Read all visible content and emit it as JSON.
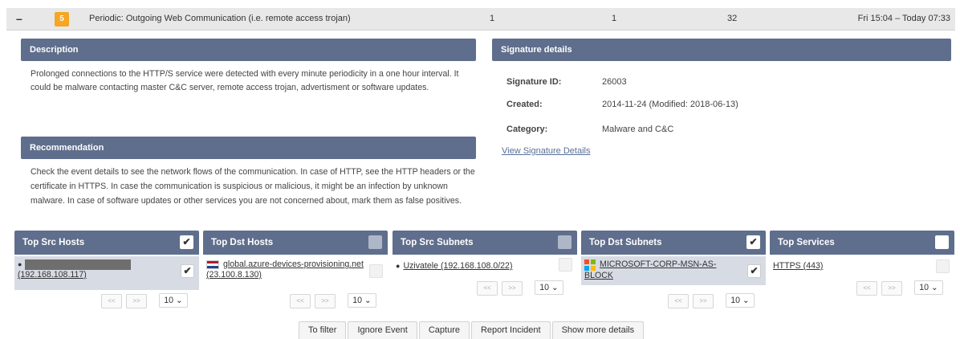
{
  "event": {
    "collapse": "–",
    "severity": "5",
    "title": "Periodic: Outgoing Web Communication (i.e. remote access trojan)",
    "col1": "1",
    "col2": "1",
    "col3": "32",
    "time": "Fri 15:04 – Today 07:33",
    "severity_color": "#f5a623"
  },
  "description": {
    "title": "Description",
    "text": "Prolonged connections to the HTTP/S service were detected with every minute periodicity in a one hour interval. It could be malware contacting master C&C server, remote access trojan, advertisment or software updates."
  },
  "recommendation": {
    "title": "Recommendation",
    "text": "Check the event details to see the network flows of the communication. In case of HTTP, see the HTTP headers or the certificate in HTTPS. In case the communication is suspicious or malicious, it might be an infection by unknown malware. In case of software updates or other services you are not concerned about, mark them as false positives."
  },
  "signature": {
    "title": "Signature details",
    "id_label": "Signature ID:",
    "id_value": "26003",
    "created_label": "Created:",
    "created_value": "2014-11-24 (Modified: 2018-06-13)",
    "category_label": "Category:",
    "category_value": "Malware and C&C",
    "link": "View Signature Details"
  },
  "boxes": {
    "src_hosts": {
      "title": "Top Src Hosts",
      "checked": true,
      "item": "(192.168.108.117)",
      "item_checked": true
    },
    "dst_hosts": {
      "title": "Top Dst Hosts",
      "checked": false,
      "item": "global.azure-devices-provisioning.net (23.100.8.130)",
      "item_checked": false
    },
    "src_subnets": {
      "title": "Top Src Subnets",
      "checked": false,
      "item": "Uzivatele (192.168.108.0/22)",
      "item_checked": false
    },
    "dst_subnets": {
      "title": "Top Dst Subnets",
      "checked": true,
      "item": "MICROSOFT-CORP-MSN-AS-BLOCK",
      "item_checked": true
    },
    "services": {
      "title": "Top Services",
      "checked": false,
      "item": "HTTPS (443)",
      "item_checked": false
    }
  },
  "pager": {
    "prev": "<<",
    "next": ">>",
    "per_page": "10"
  },
  "actions": {
    "to_filter": "To filter",
    "ignore": "Ignore Event",
    "capture": "Capture",
    "report": "Report Incident",
    "more": "Show more details"
  },
  "colors": {
    "panel_header": "#5f6e8c",
    "selected_row": "#d7dbe4",
    "link": "#5a6f98"
  }
}
